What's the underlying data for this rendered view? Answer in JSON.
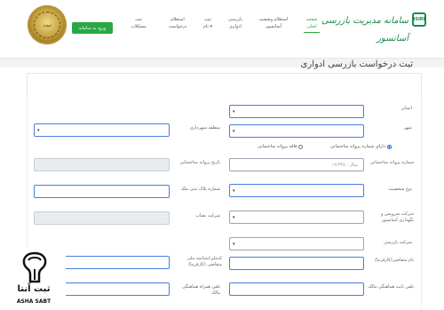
{
  "header": {
    "brand_title": "سامانه مدیریت بازرسی آسانسور",
    "brand_logo_text": "ISIRI",
    "login_button": "ورود به سامانه",
    "seal_text": "ثبت",
    "nav": [
      {
        "line1": "صفحه",
        "line2": "اصلی"
      },
      {
        "line1": "استعلام وضعیت",
        "line2": "آسانسور"
      },
      {
        "line1": "بازرسی",
        "line2": "ادواری"
      },
      {
        "line1": "ثبت",
        "line2": "نام ▾"
      },
      {
        "line1": "استعلام",
        "line2": "درخواست"
      },
      {
        "line1": "ثبت",
        "line2": "مشکلات"
      }
    ]
  },
  "page": {
    "title": "ثبت درخواست بازرسی ادواری"
  },
  "form": {
    "province_label": "استان",
    "city_label": "شهر",
    "municipal_zone_label": "منطقه شهرداری",
    "radio_has_permit": "دارای شماره پروانه ساختمانی",
    "radio_no_permit": "فاقد پروانه ساختمانی",
    "permit_number_label": "شماره پروانه ساختمانی",
    "permit_number_placeholder": "مثال : ۱۲/۳۴۵",
    "permit_date_label": "تاریخ پروانه ساختمانی",
    "entity_type_label": "نوع شخصیت",
    "plate_number_label": "شماره پلاک ثبتی ملک",
    "service_company_label": "شرکت سرویس و نگهداری آسانسور",
    "installer_company_label": "شرکت نصاب",
    "inspection_company_label": "شرکت بازرسی",
    "applicant_name_label": "نام متقاضی(کارفرما)",
    "applicant_id_label": "کدملی/شناسه ملی متقاضی (کارفرما)",
    "owner_phone_label": "تلفن ثابت هماهنگی مالک",
    "owner_mobile_label": "تلفن همراه هماهنگی مالک",
    "caret": "▾"
  },
  "watermark": {
    "fa": "ثبت آنتا",
    "en": "ASHA SABT"
  },
  "colors": {
    "accent": "#27a844",
    "input_border": "#9aa4b1",
    "input_focus": "#4a7de0",
    "disabled_bg": "#e9ecef"
  }
}
